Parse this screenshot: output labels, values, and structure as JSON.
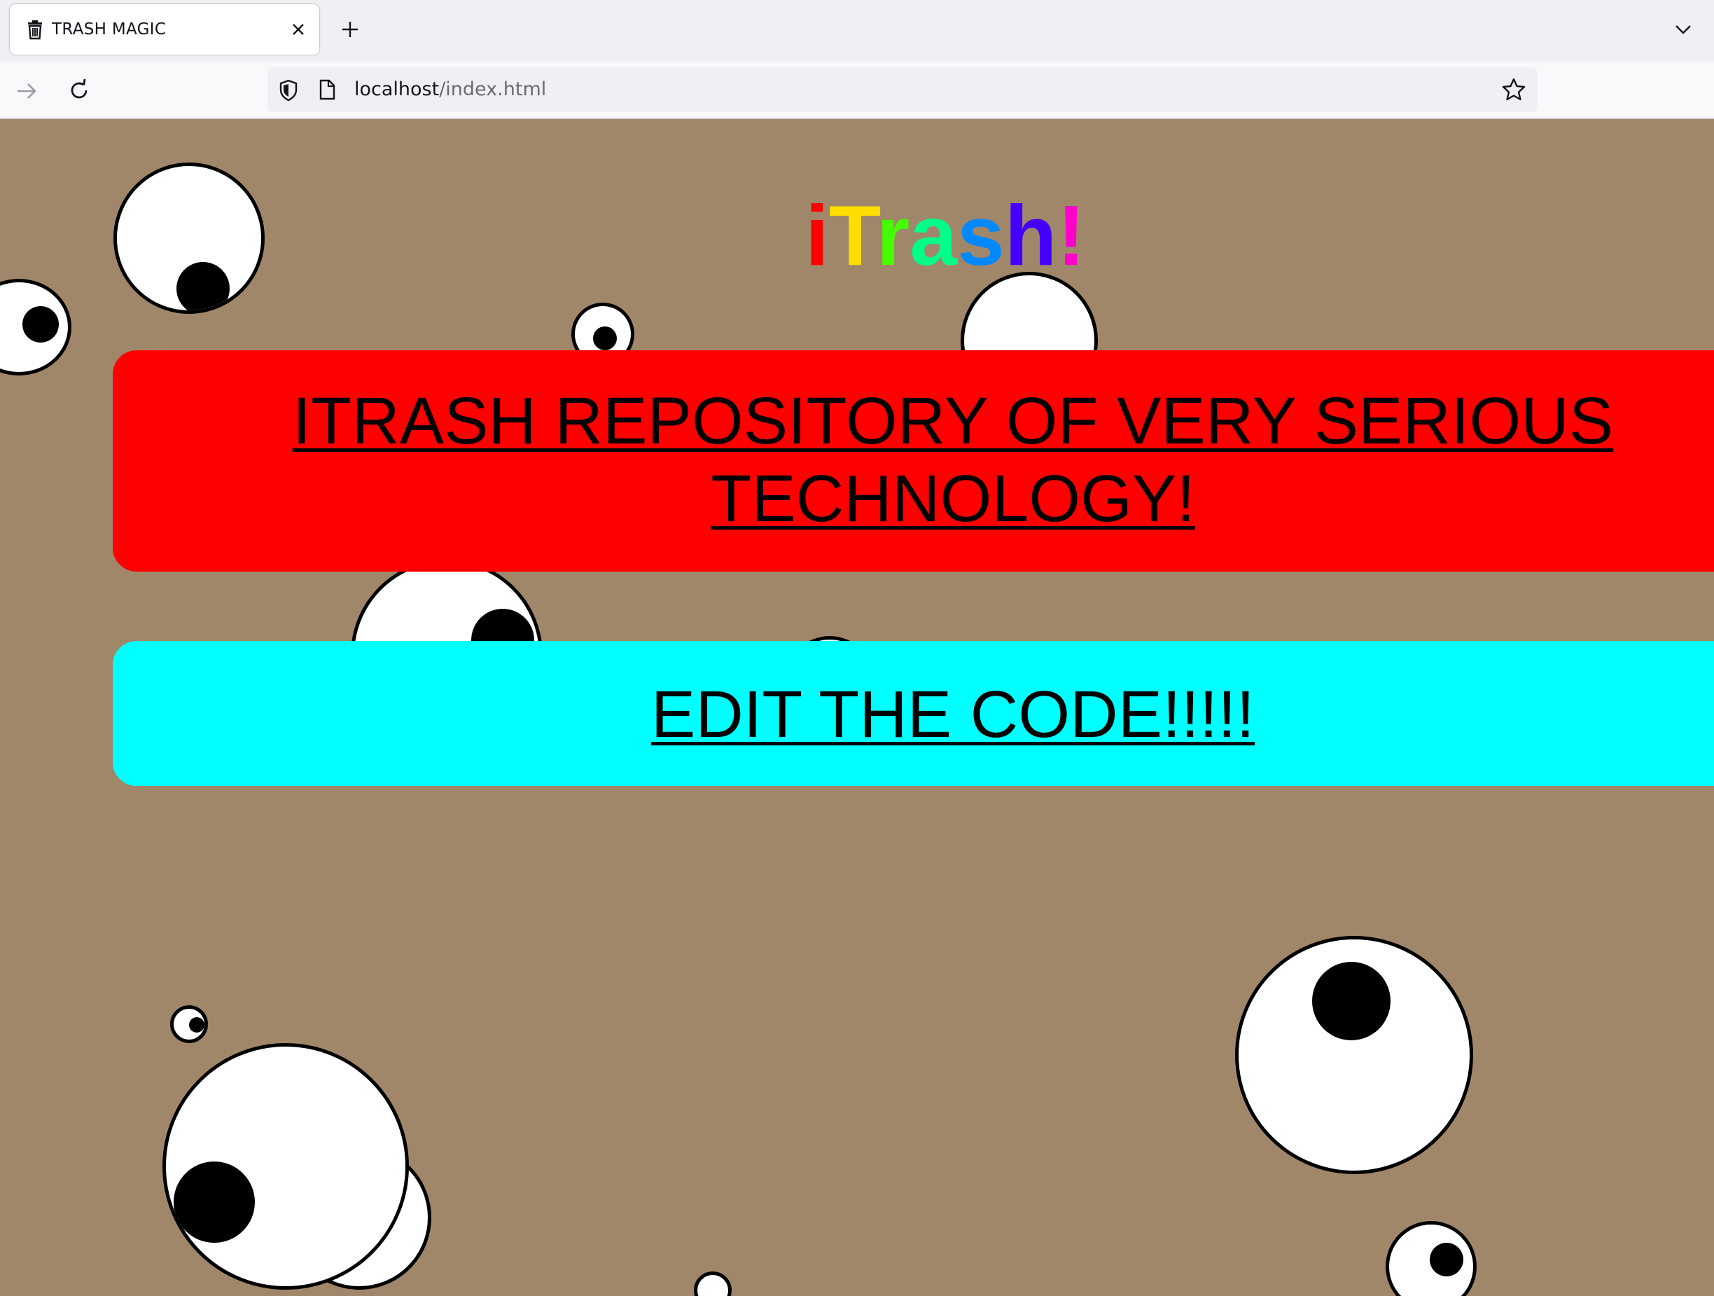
{
  "browser": {
    "tab": {
      "title": "TRASH MAGIC",
      "icon": "trash-can-icon"
    },
    "toolbar_icons": {
      "close_tab": "close-icon",
      "new_tab": "plus-icon",
      "list_tabs": "chevron-down-icon",
      "forward": "arrow-right-icon",
      "reload": "reload-icon",
      "tracking_protection": "shield-icon",
      "page_info": "page-icon",
      "bookmark": "star-icon"
    },
    "url": {
      "host": "localhost",
      "path": "/index.html"
    }
  },
  "page": {
    "background_color": "#a0876a",
    "title_letters": [
      {
        "char": "i",
        "color": "#ff0000"
      },
      {
        "char": "T",
        "color": "#ffdd00"
      },
      {
        "char": "r",
        "color": "#44ff00"
      },
      {
        "char": "a",
        "color": "#00ff88"
      },
      {
        "char": "s",
        "color": "#0088ff"
      },
      {
        "char": "h",
        "color": "#4400ff"
      },
      {
        "char": "!",
        "color": "#ff00cc"
      }
    ],
    "repo_banner": {
      "line1": "ITRASH REPOSITORY OF VERY SERIOUS",
      "line2": "TECHNOLOGY!",
      "color": "#ff0000"
    },
    "edit_banner": {
      "label": "EDIT THE CODE!!!!!",
      "color": "#00ffff"
    }
  }
}
